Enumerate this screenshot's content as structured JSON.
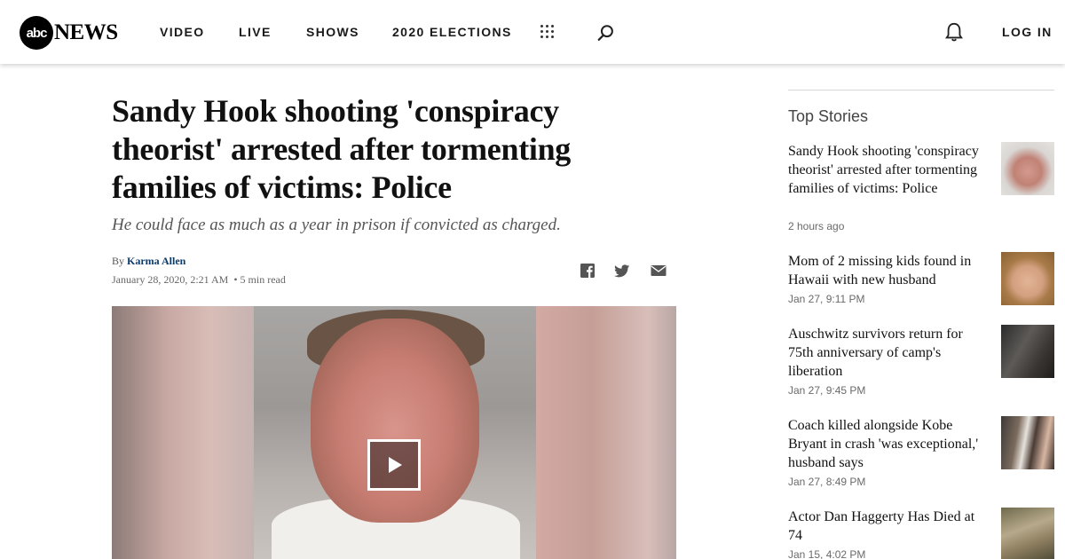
{
  "header": {
    "logo_abc": "abc",
    "logo_news": "NEWS",
    "nav": [
      "VIDEO",
      "LIVE",
      "SHOWS",
      "2020 ELECTIONS"
    ],
    "login": "LOG IN",
    "icons": [
      "grid-menu-icon",
      "search-icon",
      "bell-icon"
    ]
  },
  "article": {
    "headline": "Sandy Hook shooting 'conspiracy theorist' arrested after tormenting families of victims: Police",
    "subhead": "He could face as much as a year in prison if convicted as charged.",
    "by": "By",
    "author": "Karma Allen",
    "date": "January 28, 2020, 2:21 AM",
    "read_time": "• 5 min read",
    "share_icons": [
      "facebook-icon",
      "twitter-icon",
      "email-icon"
    ],
    "video": {
      "control": "play-button"
    }
  },
  "sidebar": {
    "title": "Top Stories",
    "stories": [
      {
        "title": "Sandy Hook shooting 'conspiracy theorist' arrested after tormenting families of victims: Police",
        "time": "2 hours ago"
      },
      {
        "title": "Mom of 2 missing kids found in Hawaii with new husband",
        "time": "Jan 27, 9:11 PM"
      },
      {
        "title": "Auschwitz survivors return for 75th anniversary of camp's liberation",
        "time": "Jan 27, 9:45 PM"
      },
      {
        "title": "Coach killed alongside Kobe Bryant in crash 'was exceptional,' husband says",
        "time": "Jan 27, 8:49 PM"
      },
      {
        "title": "Actor Dan Haggerty Has Died at 74",
        "time": "Jan 15, 4:02 PM"
      }
    ]
  },
  "colors": {
    "author_link": "#0a3a6b",
    "text": "#111111",
    "muted": "#6a6a6a"
  }
}
